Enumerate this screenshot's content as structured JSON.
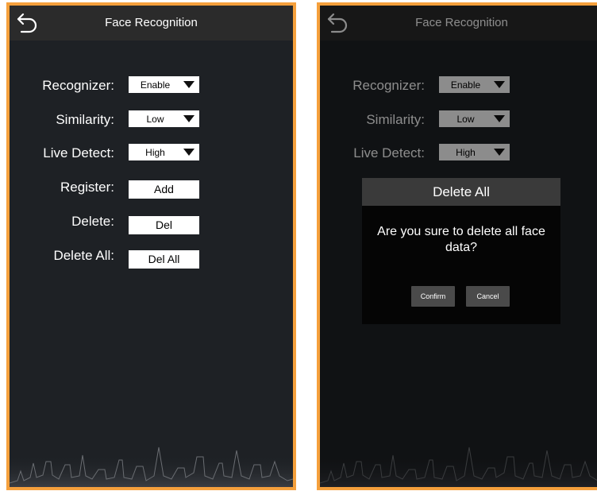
{
  "left_screen": {
    "title": "Face Recognition",
    "rows": [
      {
        "label": "Recognizer:",
        "type": "select",
        "value": "Enable"
      },
      {
        "label": "Similarity:",
        "type": "select",
        "value": "Low"
      },
      {
        "label": "Live Detect:",
        "type": "select",
        "value": "High"
      },
      {
        "label": "Register:",
        "type": "button",
        "value": "Add"
      },
      {
        "label": "Delete:",
        "type": "button",
        "value": "Del"
      },
      {
        "label": "Delete All:",
        "type": "button",
        "value": "Del All"
      }
    ]
  },
  "right_screen": {
    "title": "Face Recognition",
    "rows": [
      {
        "label": "Recognizer:",
        "value": "Enable"
      },
      {
        "label": "Similarity:",
        "value": "Low"
      },
      {
        "label": "Live Detect:",
        "value": "High"
      }
    ],
    "dialog": {
      "title": "Delete All",
      "message": "Are you sure to delete all face data?",
      "confirm_label": "Confirm",
      "cancel_label": "Cancel"
    }
  },
  "colors": {
    "frame": "#f5a03c",
    "background": "#1e2125",
    "titlebar": "#2b2b2b"
  },
  "icons": {
    "back": "back-arrow-icon",
    "skyline": "city-skyline-decoration"
  }
}
